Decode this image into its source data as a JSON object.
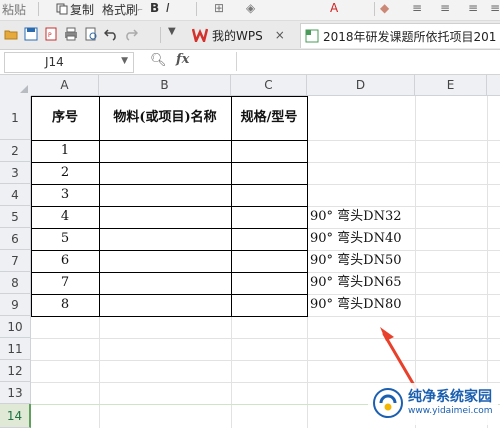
{
  "ribbon": {
    "paste_label": "粘贴",
    "copy_label": "复制",
    "format_painter_label": "格式刷"
  },
  "tabs": [
    {
      "label": "我的WPS",
      "close": "×"
    },
    {
      "label": "2018年研发课题所依托项目201"
    }
  ],
  "formula_bar": {
    "name_box": "J14",
    "fx_label": "fx",
    "formula": ""
  },
  "columns": [
    "A",
    "B",
    "C",
    "D",
    "E"
  ],
  "rows": [
    "1",
    "2",
    "3",
    "4",
    "5",
    "6",
    "7",
    "8",
    "9",
    "10",
    "11",
    "12",
    "13",
    "14"
  ],
  "header": {
    "col_a": "序号",
    "col_b": "物料(或项目)名称",
    "col_c": "规格/型号"
  },
  "serial_numbers": [
    "1",
    "2",
    "3",
    "4",
    "5",
    "6",
    "7",
    "8"
  ],
  "d_values": [
    "90° 弯头DN32",
    "90° 弯头DN40",
    "90° 弯头DN50",
    "90° 弯头DN65",
    "90° 弯头DN80"
  ],
  "watermark": {
    "title": "纯净系统家园",
    "url": "www.yidaimei.com"
  },
  "colors": {
    "arrow": "#e8402a",
    "wps_red": "#d4322c",
    "selected_row": "#5fa05f"
  }
}
